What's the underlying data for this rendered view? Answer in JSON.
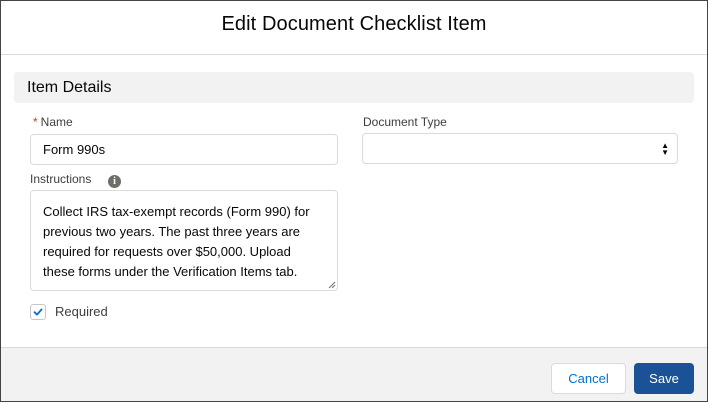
{
  "modal": {
    "title": "Edit Document Checklist Item"
  },
  "section": {
    "title": "Item Details"
  },
  "form": {
    "name_label": "Name",
    "name_required_marker": "*",
    "name_value": "Form 990s",
    "document_type_label": "Document Type",
    "document_type_value": "",
    "instructions_label": "Instructions",
    "instructions_info_icon": "info-icon",
    "instructions_value": "Collect IRS tax-exempt records (Form 990) for previous two years. The past three years are required for requests over $50,000. Upload these forms under the Verification Items tab.",
    "required_label": "Required",
    "required_checked": true
  },
  "footer": {
    "cancel_label": "Cancel",
    "save_label": "Save"
  },
  "colors": {
    "brand_button": "#1b5297",
    "link": "#0070d2",
    "required_star": "#c23934",
    "section_bg": "#f3f2f2"
  }
}
